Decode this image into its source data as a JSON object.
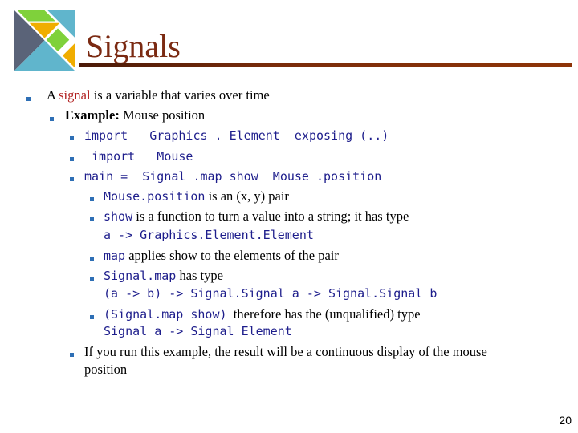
{
  "slide": {
    "title": "Signals",
    "page_number": "20",
    "bullets": {
      "b1": {
        "pre": "A ",
        "highlight": "signal",
        "post": " is a variable that varies over time"
      },
      "b2": {
        "bold": "Example:",
        "text": " Mouse position"
      },
      "code1": "import   Graphics . Element  exposing (..)",
      "code2": " import   Mouse",
      "code3": "main =  Signal .map show  Mouse .position",
      "b4a": {
        "code": "Mouse.position",
        "text": " is an (x, y) pair"
      },
      "b4b": {
        "code": "show",
        "text": " is a function to turn a value into a string; it has type",
        "code2": "a -> Graphics.Element.Element"
      },
      "b4c": {
        "code": "map",
        "text": " applies show to the elements of the pair"
      },
      "b4d": {
        "code": "Signal.map",
        "text": " has type",
        "code2": "(a -> b) -> Signal.Signal a -> Signal.Signal b"
      },
      "b4e": {
        "code": "(Signal.map show)",
        "text": "  therefore has the (unqualified) type",
        "code2": "Signal a -> Signal Element"
      },
      "b5": {
        "line1": "If you run this example, the result will be a continuous display of the mouse",
        "line2": "position"
      }
    }
  }
}
